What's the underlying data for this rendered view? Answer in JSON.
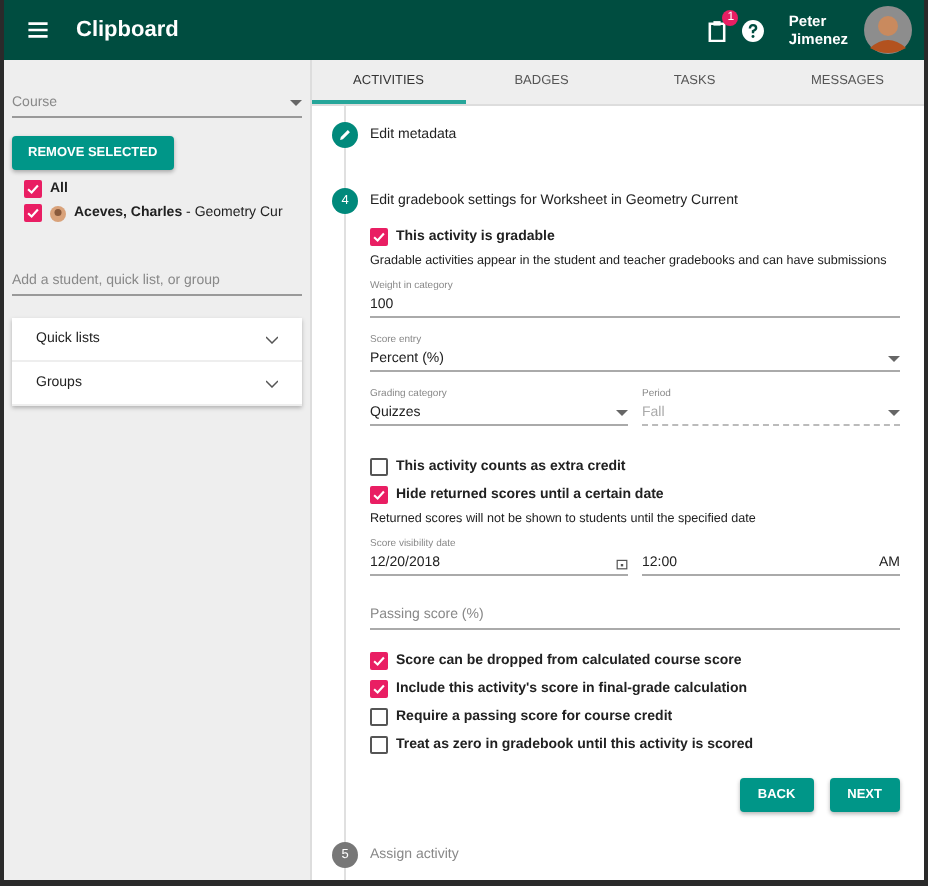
{
  "header": {
    "title": "Clipboard",
    "notification_count": "1",
    "user_name": [
      "Peter",
      "Jimenez"
    ]
  },
  "sidebar": {
    "course": {
      "placeholder": "Course"
    },
    "remove_button": "REMOVE SELECTED",
    "students": [
      {
        "name": "All",
        "checked": true,
        "avatar": false
      },
      {
        "name": "Aceves, Charles",
        "detail": " - Geometry Cur",
        "checked": true,
        "avatar": true
      }
    ],
    "add_field": {
      "placeholder": "Add a student, quick list, or group"
    },
    "sections": [
      {
        "label": "Quick lists",
        "expanded": false
      },
      {
        "label": "Groups",
        "expanded": false
      }
    ]
  },
  "tabs": [
    {
      "label": "ACTIVITIES",
      "selected": true
    },
    {
      "label": "BADGES",
      "selected": false
    },
    {
      "label": "TASKS",
      "selected": false
    },
    {
      "label": "MESSAGES",
      "selected": false
    }
  ],
  "steps": [
    {
      "label": "Edit metadata",
      "kind": "done"
    },
    {
      "number": "4",
      "label": "Edit gradebook settings for Worksheet in Geometry Current",
      "kind": "active"
    }
  ],
  "gradable": {
    "label": "This activity is gradable",
    "checked": true,
    "description": "Gradable activities appear in the student and teacher gradebooks and can have submissions"
  },
  "weight": {
    "label": "Weight in category",
    "value": "100"
  },
  "score_entry": {
    "label": "Score entry",
    "value": "Percent (%)"
  },
  "grading_category": {
    "label": "Grading category",
    "value": "Quizzes"
  },
  "period": {
    "label": "Period",
    "value": "Fall",
    "disabled": true
  },
  "extra_credit": {
    "label": "This activity counts as extra credit",
    "checked": false
  },
  "hide_scores": {
    "label": "Hide returned scores until a certain date",
    "checked": true,
    "description": "Returned scores will not be shown to students until the specified date"
  },
  "visibility_date": {
    "label": "Score visibility date",
    "value": "12/20/2018",
    "time": "12:00",
    "ampm": "AM"
  },
  "passing_score": {
    "placeholder": "Passing score (%)"
  },
  "options": [
    {
      "label": "Score can be dropped from calculated course score",
      "checked": true
    },
    {
      "label": "Include this activity's score in final-grade calculation",
      "checked": true
    },
    {
      "label": "Require a passing score for course credit",
      "checked": false
    },
    {
      "label": "Treat as zero in gradebook until this activity is scored",
      "checked": false
    }
  ],
  "buttons": [
    "BACK",
    "NEXT"
  ],
  "next_step": {
    "number": "5",
    "label": "Assign activity"
  }
}
